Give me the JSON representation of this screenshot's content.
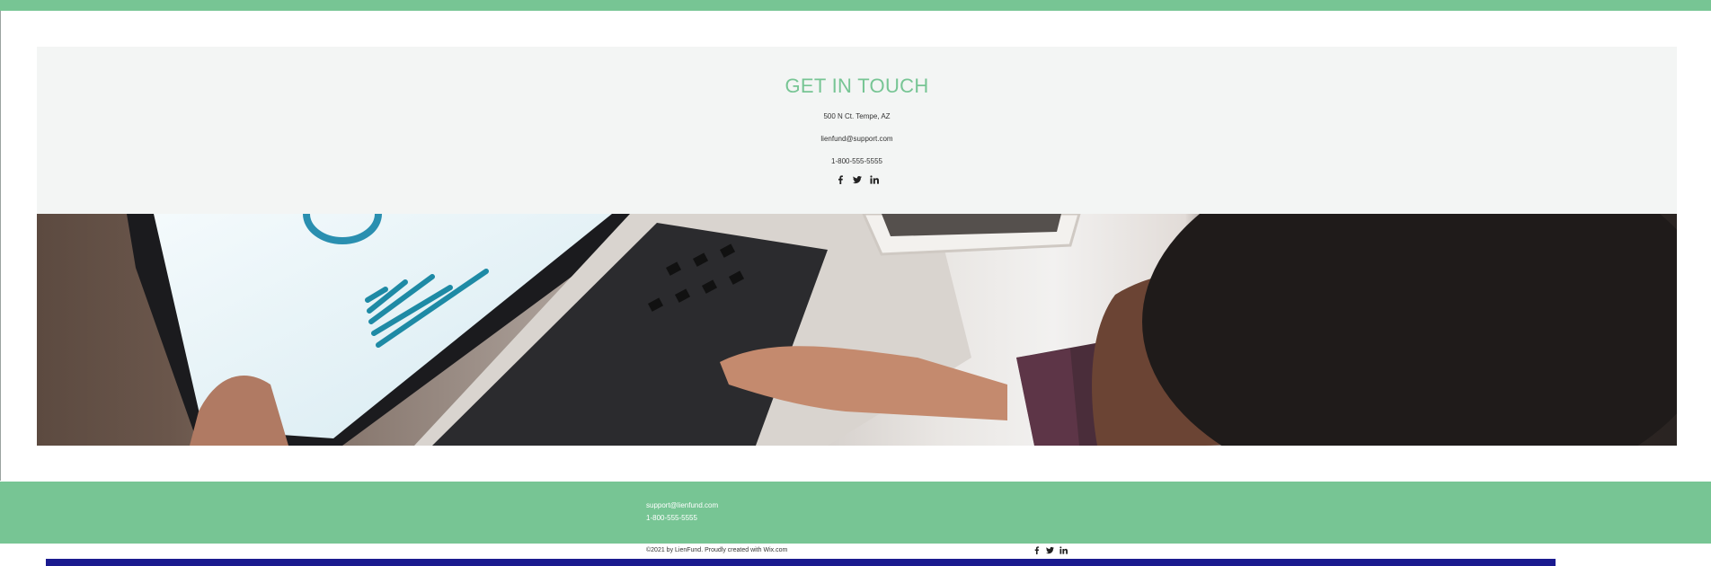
{
  "colors": {
    "accent": "#77c594",
    "contact_bg": "#f3f5f4",
    "text": "#333333"
  },
  "contact": {
    "title": "GET IN TOUCH",
    "address": "500 N Ct. Tempe, AZ",
    "email": "lienfund@support.com",
    "phone": "1-800-555-5555",
    "social_icons": [
      "facebook-icon",
      "twitter-icon",
      "linkedin-icon"
    ]
  },
  "hero": {
    "image": "hands typing on laptop keyboard beside a bar chart screen and tablet"
  },
  "footer": {
    "email": "support@lienfund.com",
    "phone": "1-800-555-5555",
    "copyright": "©2021 by LienFund. Proudly created with Wix.com",
    "social_icons": [
      "facebook-icon",
      "twitter-icon",
      "linkedin-icon"
    ]
  }
}
